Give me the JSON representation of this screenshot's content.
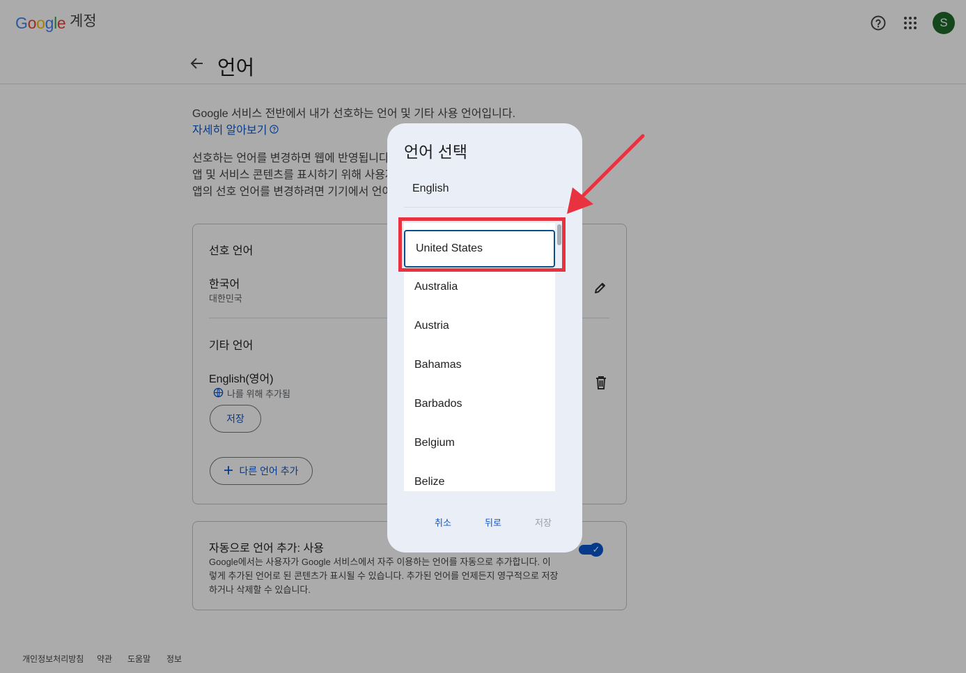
{
  "header": {
    "logo_text": "Google",
    "logo_suffix": "계정",
    "avatar_letter": "S",
    "icons": [
      "help-icon",
      "apps-grid-icon"
    ]
  },
  "page": {
    "back_icon": "arrow-left-icon",
    "title": "언어",
    "intro": "Google 서비스 전반에서 내가 선호하는 언어 및 기타 사용 언어입니다.",
    "learn_more": "자세히 알아보기",
    "para_line1": "선호하는 언어를 변경하면 웹에 반영됩니다. G",
    "para_line2": "앱 및 서비스 콘텐츠를 표시하기 위해 사용자의",
    "para_line3": "앱의 선호 언어를 변경하려면 기기에서 언어 설"
  },
  "preferred": {
    "section_title": "선호 언어",
    "language": "한국어",
    "region": "대한민국"
  },
  "other": {
    "section_title": "기타 언어",
    "language": "English(영어)",
    "note": "나를 위해 추가됨",
    "save_button": "저장",
    "add_button": "다른 언어 추가"
  },
  "auto": {
    "title": "자동으로 언어 추가: 사용",
    "desc_line1": "Google에서는 사용자가 Google 서비스에서 자주 이용하는 언어를 자동으로 추가합니다. 이",
    "desc_line2": "렇게 추가된 언어로 된 콘텐츠가 표시될 수 있습니다. 추가된 언어를 언제든지 영구적으로 저장",
    "desc_line3": "하거나 삭제할 수 있습니다.",
    "toggle_on": true
  },
  "footer": {
    "links": [
      "개인정보처리방침",
      "약관",
      "도움말",
      "정보"
    ]
  },
  "dialog": {
    "title": "언어 선택",
    "selected_language": "English",
    "regions": [
      "United States",
      "Australia",
      "Austria",
      "Bahamas",
      "Barbados",
      "Belgium",
      "Belize"
    ],
    "focused_region": "United States",
    "buttons": {
      "cancel": "취소",
      "back": "뒤로",
      "save": "저장"
    }
  },
  "colors": {
    "accent": "#0b57d0",
    "annotation": "#e8323f",
    "avatar": "#1e6b2a"
  }
}
